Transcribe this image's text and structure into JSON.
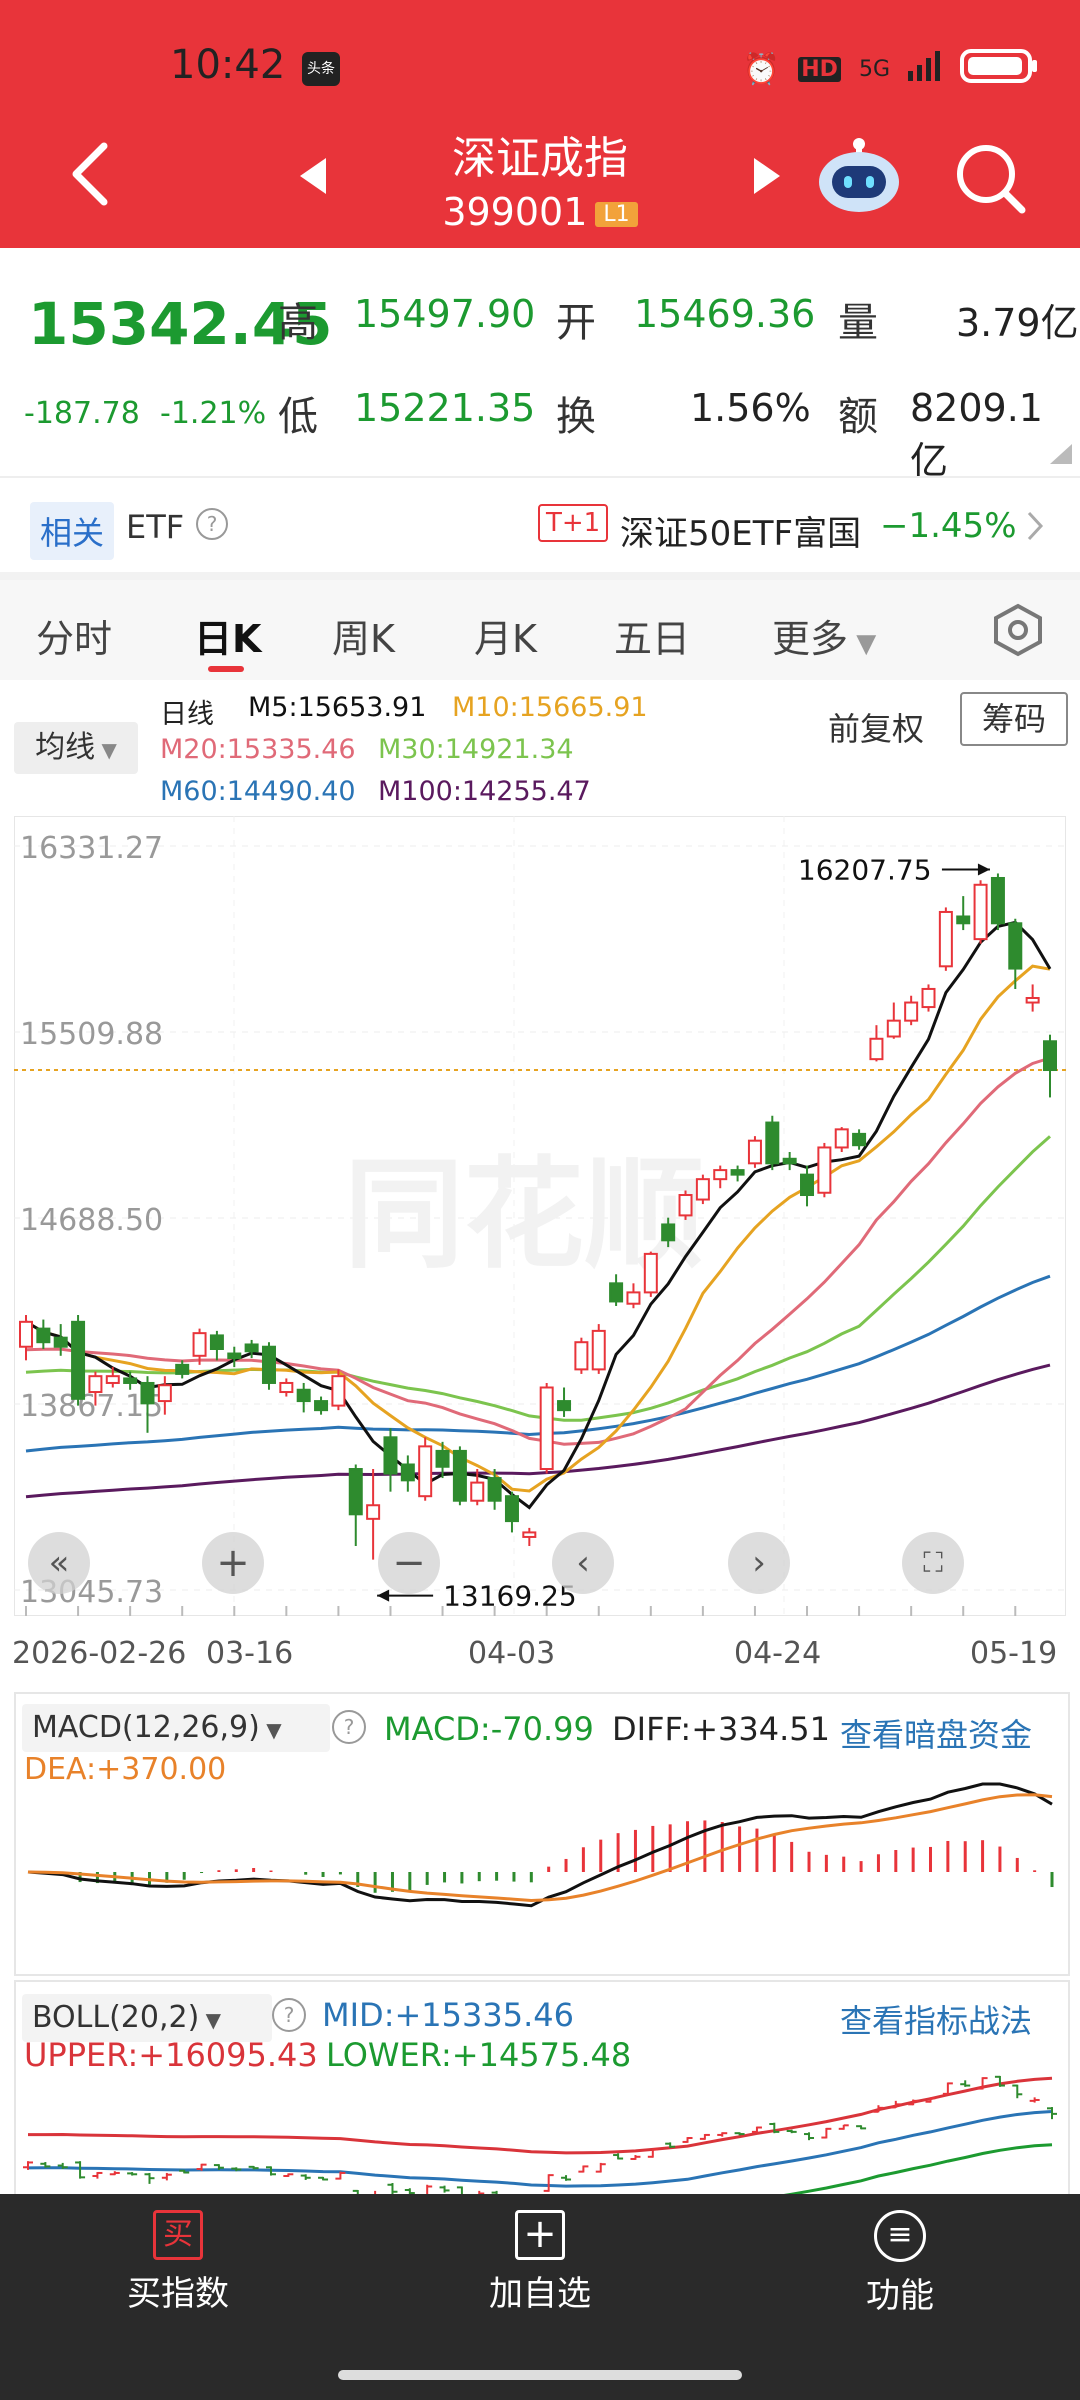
{
  "status_bar": {
    "time": "10:42",
    "news_badge": "头条",
    "network": "5G",
    "hd": "HD"
  },
  "header": {
    "title": "深证成指",
    "code": "399001",
    "level_badge": "L1"
  },
  "quote": {
    "price": "15342.45",
    "change": "-187.78",
    "change_pct": "-1.21%",
    "high_label": "高",
    "high": "15497.90",
    "open_label": "开",
    "open": "15469.36",
    "volume_label": "量",
    "volume": "3.79亿",
    "low_label": "低",
    "low": "15221.35",
    "turnover_label": "换",
    "turnover": "1.56%",
    "amount_label": "额",
    "amount": "8209.1亿"
  },
  "etf_row": {
    "tag": "相关",
    "etf": "ETF",
    "t1_badge": "T+1",
    "name": "深证50ETF富国",
    "change": "−1.45%"
  },
  "tabs": [
    "分时",
    "日K",
    "周K",
    "月K",
    "五日",
    "更多"
  ],
  "ma_panel": {
    "dropdown": "均线",
    "period": "日线",
    "m5": "M5:15653.91",
    "m10": "M10:15665.91",
    "m20": "M20:15335.46",
    "m30": "M30:14921.34",
    "m60": "M60:14490.40",
    "m100": "M100:14255.47",
    "adjust": "前复权",
    "chip_button": "筹码"
  },
  "chart": {
    "y_labels": [
      "16331.27",
      "15509.88",
      "14688.50",
      "13867.15",
      "13045.73"
    ],
    "x_labels": [
      "2026-02-26",
      "03-16",
      "04-03",
      "04-24",
      "05-19"
    ],
    "high_marker": "16207.75",
    "low_marker": "13169.25",
    "colors": {
      "up": "#e8343a",
      "down": "#2e8b2e",
      "m5": "#111111",
      "m10": "#e6a321",
      "m20": "#e06a78",
      "m30": "#7cc44e",
      "m60": "#2a74b5",
      "m100": "#5a1a5e"
    }
  },
  "macd": {
    "title": "MACD(12,26,9)",
    "macd": "MACD:-70.99",
    "diff": "DIFF:+334.51",
    "dea": "DEA:+370.00",
    "link": "查看暗盘资金"
  },
  "boll": {
    "title": "BOLL(20,2)",
    "mid": "MID:+15335.46",
    "upper": "UPPER:+16095.43",
    "lower": "LOWER:+14575.48",
    "link": "查看指标战法"
  },
  "bottom_nav": {
    "buy": "买指数",
    "buy_icon": "买",
    "add": "加自选",
    "func": "功能"
  },
  "chart_data": {
    "type": "candlestick",
    "y_range": [
      13045.73,
      16331.27
    ],
    "candles": [
      {
        "o": 14120,
        "c": 14230,
        "h": 14260,
        "l": 14060
      },
      {
        "o": 14200,
        "c": 14140,
        "h": 14240,
        "l": 14110
      },
      {
        "o": 14160,
        "c": 14120,
        "h": 14220,
        "l": 14080
      },
      {
        "o": 14230,
        "c": 13890,
        "h": 14260,
        "l": 13860
      },
      {
        "o": 13920,
        "c": 13990,
        "h": 14010,
        "l": 13860
      },
      {
        "o": 13960,
        "c": 13990,
        "h": 14030,
        "l": 13940
      },
      {
        "o": 13980,
        "c": 13960,
        "h": 14010,
        "l": 13930
      },
      {
        "o": 13960,
        "c": 13870,
        "h": 13990,
        "l": 13740
      },
      {
        "o": 13880,
        "c": 13950,
        "h": 13990,
        "l": 13820
      },
      {
        "o": 14040,
        "c": 14000,
        "h": 14060,
        "l": 13980
      },
      {
        "o": 14080,
        "c": 14180,
        "h": 14200,
        "l": 14040
      },
      {
        "o": 14170,
        "c": 14110,
        "h": 14190,
        "l": 14060
      },
      {
        "o": 14090,
        "c": 14070,
        "h": 14120,
        "l": 14030
      },
      {
        "o": 14130,
        "c": 14100,
        "h": 14150,
        "l": 14070
      },
      {
        "o": 14120,
        "c": 13960,
        "h": 14140,
        "l": 13930
      },
      {
        "o": 13920,
        "c": 13960,
        "h": 13980,
        "l": 13900
      },
      {
        "o": 13930,
        "c": 13880,
        "h": 13960,
        "l": 13830
      },
      {
        "o": 13880,
        "c": 13840,
        "h": 13900,
        "l": 13820
      },
      {
        "o": 13860,
        "c": 13990,
        "h": 14020,
        "l": 13840
      },
      {
        "o": 13580,
        "c": 13380,
        "h": 13600,
        "l": 13240
      },
      {
        "o": 13360,
        "c": 13420,
        "h": 13580,
        "l": 13180
      },
      {
        "o": 13720,
        "c": 13560,
        "h": 13760,
        "l": 13480
      },
      {
        "o": 13600,
        "c": 13530,
        "h": 13640,
        "l": 13480
      },
      {
        "o": 13460,
        "c": 13680,
        "h": 13720,
        "l": 13440
      },
      {
        "o": 13660,
        "c": 13590,
        "h": 13700,
        "l": 13540
      },
      {
        "o": 13660,
        "c": 13440,
        "h": 13680,
        "l": 13420
      },
      {
        "o": 13440,
        "c": 13520,
        "h": 13580,
        "l": 13420
      },
      {
        "o": 13540,
        "c": 13440,
        "h": 13580,
        "l": 13400
      },
      {
        "o": 13460,
        "c": 13350,
        "h": 13480,
        "l": 13300
      },
      {
        "o": 13280,
        "c": 13300,
        "h": 13320,
        "l": 13240
      },
      {
        "o": 13580,
        "c": 13940,
        "h": 13960,
        "l": 13560
      },
      {
        "o": 13880,
        "c": 13840,
        "h": 13940,
        "l": 13810
      },
      {
        "o": 14020,
        "c": 14140,
        "h": 14160,
        "l": 14000
      },
      {
        "o": 14020,
        "c": 14190,
        "h": 14220,
        "l": 14000
      },
      {
        "o": 14400,
        "c": 14320,
        "h": 14440,
        "l": 14300
      },
      {
        "o": 14310,
        "c": 14360,
        "h": 14400,
        "l": 14290
      },
      {
        "o": 14360,
        "c": 14530,
        "h": 14540,
        "l": 14340
      },
      {
        "o": 14660,
        "c": 14590,
        "h": 14690,
        "l": 14560
      },
      {
        "o": 14700,
        "c": 14790,
        "h": 14810,
        "l": 14680
      },
      {
        "o": 14770,
        "c": 14860,
        "h": 14880,
        "l": 14750
      },
      {
        "o": 14860,
        "c": 14900,
        "h": 14920,
        "l": 14820
      },
      {
        "o": 14900,
        "c": 14880,
        "h": 14920,
        "l": 14850
      },
      {
        "o": 14930,
        "c": 15030,
        "h": 15050,
        "l": 14910
      },
      {
        "o": 15110,
        "c": 14930,
        "h": 15140,
        "l": 14900
      },
      {
        "o": 14950,
        "c": 14930,
        "h": 14980,
        "l": 14900
      },
      {
        "o": 14880,
        "c": 14790,
        "h": 14920,
        "l": 14740
      },
      {
        "o": 14800,
        "c": 15000,
        "h": 15020,
        "l": 14780
      },
      {
        "o": 15000,
        "c": 15080,
        "h": 15090,
        "l": 14980
      },
      {
        "o": 15060,
        "c": 15010,
        "h": 15080,
        "l": 14990
      },
      {
        "o": 15390,
        "c": 15480,
        "h": 15540,
        "l": 15380
      },
      {
        "o": 15490,
        "c": 15560,
        "h": 15640,
        "l": 15480
      },
      {
        "o": 15560,
        "c": 15640,
        "h": 15670,
        "l": 15540
      },
      {
        "o": 15620,
        "c": 15700,
        "h": 15720,
        "l": 15600
      },
      {
        "o": 15800,
        "c": 16040,
        "h": 16060,
        "l": 15780
      },
      {
        "o": 16020,
        "c": 15990,
        "h": 16110,
        "l": 15960
      },
      {
        "o": 15920,
        "c": 16160,
        "h": 16180,
        "l": 15900
      },
      {
        "o": 16190,
        "c": 15990,
        "h": 16210,
        "l": 15960
      },
      {
        "o": 15990,
        "c": 15790,
        "h": 16010,
        "l": 15700
      },
      {
        "o": 15640,
        "c": 15660,
        "h": 15720,
        "l": 15600
      },
      {
        "o": 15469,
        "c": 15342,
        "h": 15498,
        "l": 15221
      }
    ]
  }
}
